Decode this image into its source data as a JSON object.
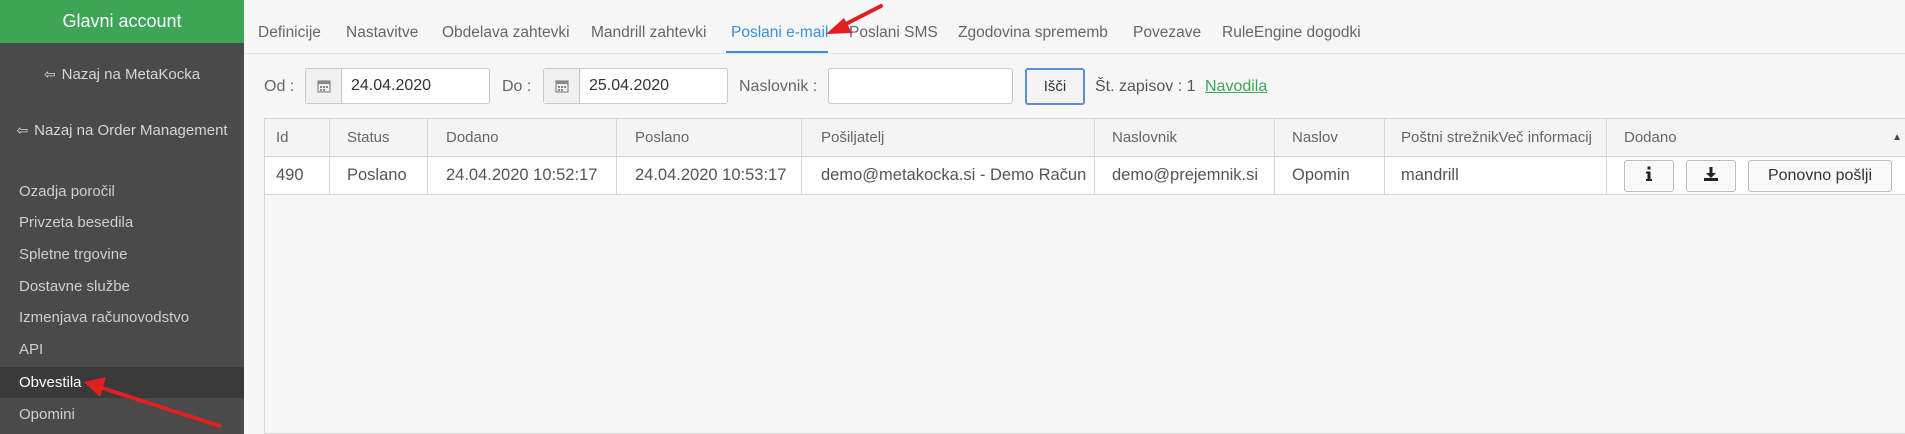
{
  "sidebar": {
    "header": "Glavni account",
    "links": [
      {
        "label": "Nazaj na MetaKocka",
        "icon": "sign-out-icon"
      },
      {
        "label": "Nazaj na Order Management",
        "icon": "sign-out-icon"
      }
    ],
    "items": [
      {
        "label": "Ozadja poročil"
      },
      {
        "label": "Privzeta besedila"
      },
      {
        "label": "Spletne trgovine"
      },
      {
        "label": "Dostavne službe"
      },
      {
        "label": "Izmenjava računovodstvo"
      },
      {
        "label": "API"
      },
      {
        "label": "Obvestila",
        "active": true
      },
      {
        "label": "Opomini"
      }
    ]
  },
  "tabs": [
    {
      "label": "Definicije"
    },
    {
      "label": "Nastavitve"
    },
    {
      "label": "Obdelava zahtevki"
    },
    {
      "label": "Mandrill zahtevki"
    },
    {
      "label": "Poslani e-mail",
      "active": true
    },
    {
      "label": "Poslani SMS"
    },
    {
      "label": "Zgodovina sprememb"
    },
    {
      "label": "Povezave"
    },
    {
      "label": "RuleEngine dogodki"
    }
  ],
  "filters": {
    "from_label": "Od :",
    "from_value": "24.04.2020",
    "to_label": "Do :",
    "to_value": "25.04.2020",
    "recipient_label": "Naslovnik :",
    "recipient_value": "",
    "search_label": "Išči",
    "count_label": "Št. zapisov : 1",
    "help_link": "Navodila"
  },
  "table": {
    "columns": [
      "Id",
      "Status",
      "Dodano",
      "Poslano",
      "Pošiljatelj",
      "Naslovnik",
      "Naslov",
      "Poštni strežnikVeč informacij",
      "Dodano"
    ],
    "rows": [
      {
        "id": "490",
        "status": "Poslano",
        "added": "24.04.2020 10:52:17",
        "sent": "24.04.2020 10:53:17",
        "sender": "demo@metakocka.si - Demo Račun",
        "recipient": "demo@prejemnik.si",
        "subject": "Opomin",
        "server": "mandrill",
        "info_icon": "info-icon",
        "download_icon": "download-icon",
        "resend_label": "Ponovno pošlji"
      }
    ]
  },
  "colors": {
    "sidebar_bg": "#4a4a4a",
    "sidebar_header": "#3da556",
    "active_tab": "#3a8fd8",
    "link_green": "#3da556",
    "annotation_arrow": "#e02020"
  }
}
